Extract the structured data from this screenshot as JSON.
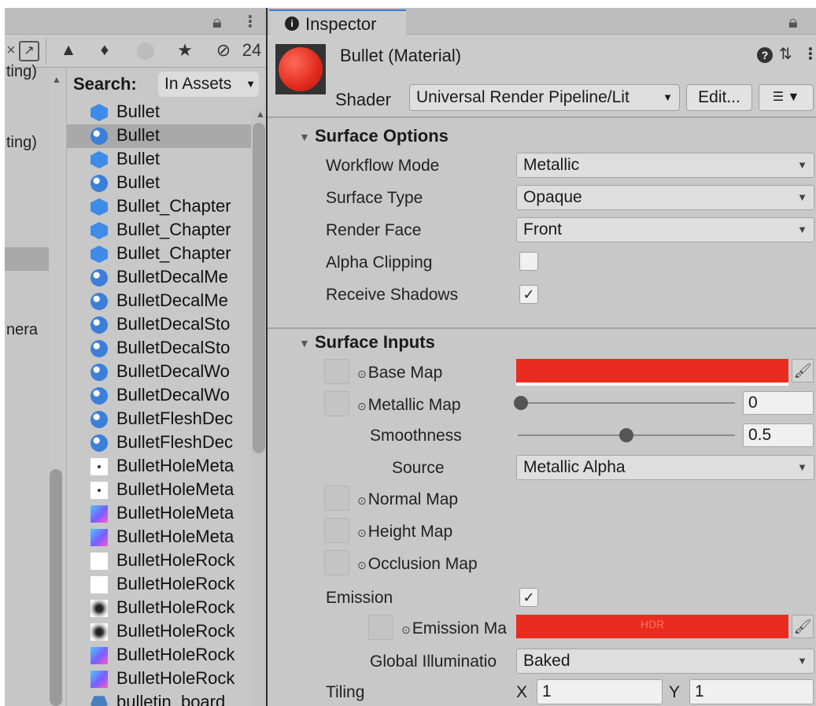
{
  "left_panel": {
    "toolbar": {
      "close_glyph": "×",
      "hidden_count": "24"
    },
    "gutter_texts": [
      "ting)",
      "ting)",
      "nera"
    ],
    "search": {
      "label": "Search:",
      "scope": "In Assets"
    },
    "assets": [
      {
        "icon": "prefab-icon",
        "label": "Bullet",
        "selected": false
      },
      {
        "icon": "material-icon",
        "label": "Bullet",
        "selected": true
      },
      {
        "icon": "prefab-icon",
        "label": "Bullet",
        "selected": false
      },
      {
        "icon": "material-icon",
        "label": "Bullet",
        "selected": false
      },
      {
        "icon": "prefab-icon",
        "label": "Bullet_Chapter",
        "selected": false
      },
      {
        "icon": "prefab-icon",
        "label": "Bullet_Chapter",
        "selected": false
      },
      {
        "icon": "prefab-icon",
        "label": "Bullet_Chapter",
        "selected": false
      },
      {
        "icon": "material-icon",
        "label": "BulletDecalMe",
        "selected": false
      },
      {
        "icon": "material-icon",
        "label": "BulletDecalMe",
        "selected": false
      },
      {
        "icon": "material-icon",
        "label": "BulletDecalSto",
        "selected": false
      },
      {
        "icon": "material-icon",
        "label": "BulletDecalSto",
        "selected": false
      },
      {
        "icon": "material-icon",
        "label": "BulletDecalWo",
        "selected": false
      },
      {
        "icon": "material-icon",
        "label": "BulletDecalWo",
        "selected": false
      },
      {
        "icon": "material-icon",
        "label": "BulletFleshDec",
        "selected": false
      },
      {
        "icon": "material-icon",
        "label": "BulletFleshDec",
        "selected": false
      },
      {
        "icon": "texture-dot-icon",
        "label": "BulletHoleMeta",
        "selected": false
      },
      {
        "icon": "texture-dot-icon",
        "label": "BulletHoleMeta",
        "selected": false
      },
      {
        "icon": "texture-normal-icon",
        "label": "BulletHoleMeta",
        "selected": false
      },
      {
        "icon": "texture-normal-icon",
        "label": "BulletHoleMeta",
        "selected": false
      },
      {
        "icon": "texture-white-icon",
        "label": "BulletHoleRock",
        "selected": false
      },
      {
        "icon": "texture-white-icon",
        "label": "BulletHoleRock",
        "selected": false
      },
      {
        "icon": "texture-blur-icon",
        "label": "BulletHoleRock",
        "selected": false
      },
      {
        "icon": "texture-blur-icon",
        "label": "BulletHoleRock",
        "selected": false
      },
      {
        "icon": "texture-normal-icon",
        "label": "BulletHoleRock",
        "selected": false
      },
      {
        "icon": "texture-normal-icon",
        "label": "BulletHoleRock",
        "selected": false
      },
      {
        "icon": "model-icon",
        "label": "bulletin_board",
        "selected": false
      }
    ]
  },
  "inspector": {
    "tab_label": "Inspector",
    "material_title": "Bullet (Material)",
    "shader_label": "Shader",
    "shader_value": "Universal Render Pipeline/Lit",
    "edit_label": "Edit...",
    "surface_options": {
      "title": "Surface Options",
      "workflow_mode": {
        "label": "Workflow Mode",
        "value": "Metallic"
      },
      "surface_type": {
        "label": "Surface Type",
        "value": "Opaque"
      },
      "render_face": {
        "label": "Render Face",
        "value": "Front"
      },
      "alpha_clipping": {
        "label": "Alpha Clipping",
        "checked": false
      },
      "receive_shadows": {
        "label": "Receive Shadows",
        "checked": true,
        "glyph": "✓"
      }
    },
    "surface_inputs": {
      "title": "Surface Inputs",
      "base_map": {
        "label": "Base Map",
        "color": "#ea2b1f"
      },
      "metallic_map": {
        "label": "Metallic Map",
        "value": "0",
        "fraction": 0
      },
      "smoothness": {
        "label": "Smoothness",
        "value": "0.5",
        "fraction": 0.5
      },
      "source": {
        "label": "Source",
        "value": "Metallic Alpha"
      },
      "normal_map": {
        "label": "Normal Map"
      },
      "height_map": {
        "label": "Height Map"
      },
      "occlusion_map": {
        "label": "Occlusion Map"
      },
      "emission": {
        "label": "Emission",
        "checked": true,
        "glyph": "✓"
      },
      "emission_map": {
        "label": "Emission Ma",
        "hdr_label": "HDR",
        "color": "#ea2b1f"
      },
      "global_illumination": {
        "label": "Global Illuminatio",
        "value": "Baked"
      },
      "tiling": {
        "label": "Tiling",
        "x_label": "X",
        "x_value": "1",
        "y_label": "Y",
        "y_value": "1"
      }
    }
  }
}
